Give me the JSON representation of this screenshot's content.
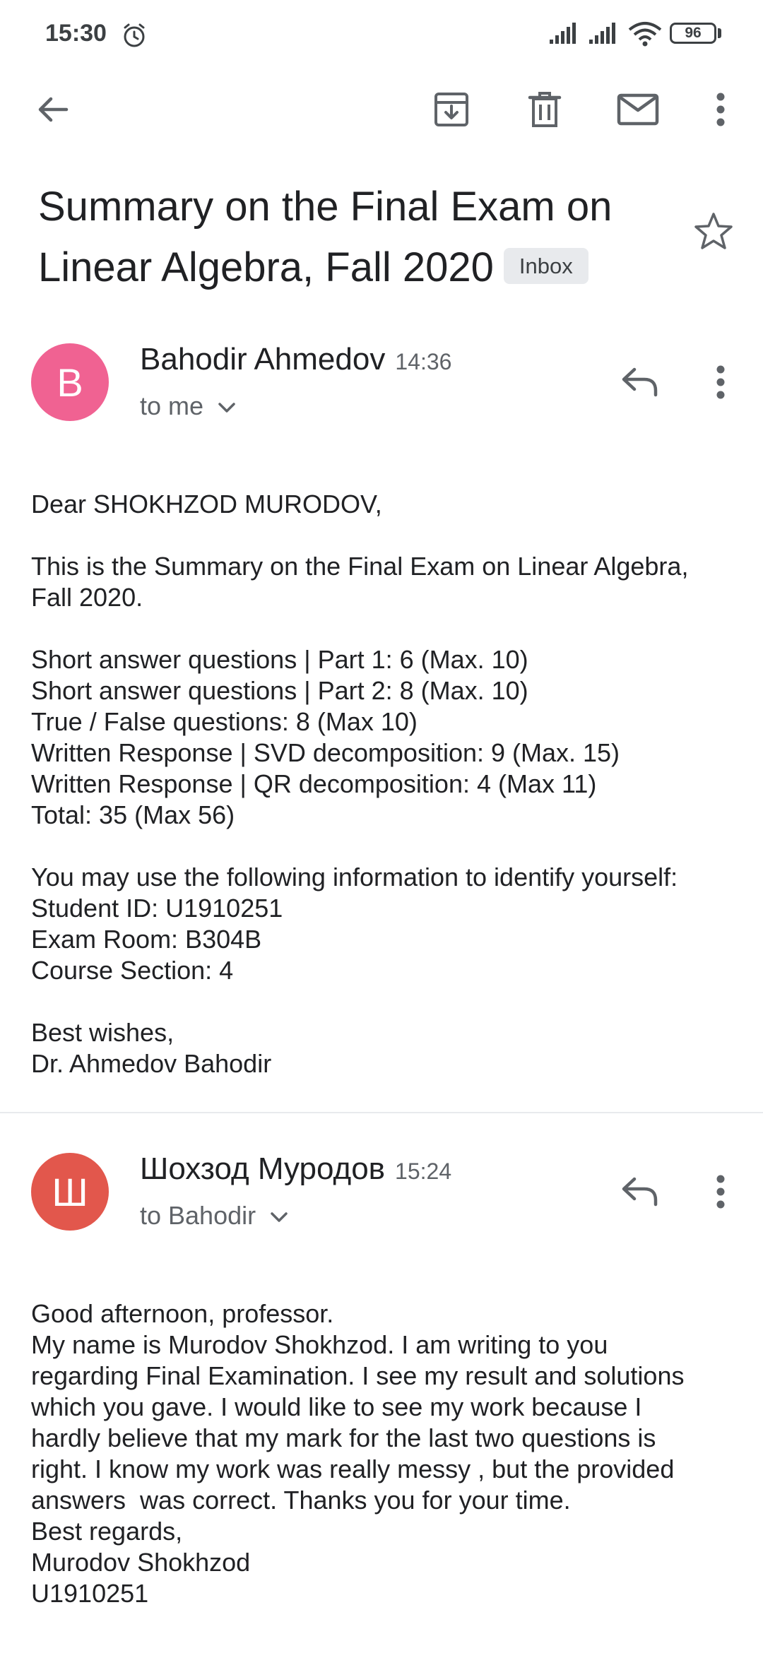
{
  "status_bar": {
    "time": "15:30",
    "battery": "96"
  },
  "toolbar": {
    "back": "back-arrow-icon",
    "archive": "archive-icon",
    "delete": "trash-icon",
    "mark_unread": "mail-icon",
    "more": "more-vert-icon"
  },
  "subject": {
    "line1": "Summary on the Final Exam on",
    "line2": "Linear Algebra, Fall 2020",
    "label": "Inbox"
  },
  "messages": [
    {
      "avatar_letter": "B",
      "avatar_color": "#f06292",
      "sender": "Bahodir Ahmedov",
      "time": "14:36",
      "recipient": "to me",
      "body": "Dear SHOKHZOD MURODOV,\n\nThis is the Summary on the Final Exam on Linear Algebra,\nFall 2020.\n\nShort answer questions | Part 1: 6 (Max. 10)\nShort answer questions | Part 2: 8 (Max. 10)\nTrue / False questions: 8 (Max 10)\nWritten Response | SVD decomposition: 9 (Max. 15)\nWritten Response | QR decomposition: 4 (Max 11)\nTotal: 35 (Max 56)\n\nYou may use the following information to identify yourself:\nStudent ID: U1910251\nExam Room: B304B\nCourse Section: 4\n\nBest wishes,\nDr. Ahmedov Bahodir"
    },
    {
      "avatar_letter": "Ш",
      "avatar_color": "#e2574c",
      "sender": "Шохзод Муродов",
      "time": "15:24",
      "recipient": "to Bahodir",
      "body": "Good afternoon, professor.\nMy name is Murodov Shokhzod. I am writing to you\nregarding Final Examination. I see my result and solutions\nwhich you gave. I would like to see my work because I\nhardly believe that my mark for the last two questions is\nright. I know my work was really messy , but the provided\nanswers  was correct. Thanks you for your time.\nBest regards,\nMurodov Shokhzod\nU1910251"
    }
  ]
}
